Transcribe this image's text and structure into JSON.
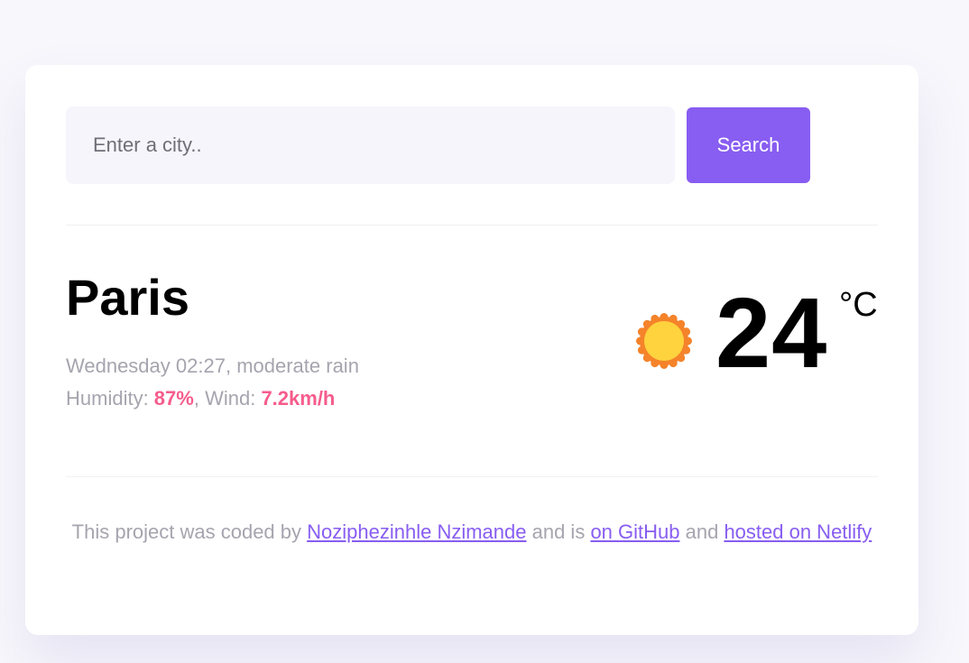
{
  "search": {
    "placeholder": "Enter a city..",
    "value": "",
    "button_label": "Search"
  },
  "weather": {
    "city": "Paris",
    "day_time": "Wednesday 02:27",
    "description": "moderate rain",
    "humidity_label": "Humidity: ",
    "humidity_value": "87%",
    "wind_label": "Wind: ",
    "wind_value": "7.2km/h",
    "temperature": "24",
    "unit": "°C",
    "icon": "sun-icon"
  },
  "footer": {
    "text_1": "This project was coded by ",
    "author_link": "Noziphezinhle Nzimande",
    "text_2": " and is ",
    "github_link": "on GitHub",
    "text_3": " and ",
    "hosted_link": "hosted on Netlify"
  },
  "colors": {
    "accent": "#885df1",
    "highlight": "#f65c8c",
    "muted_text": "#a6a4ae",
    "sun_outer": "#f5832a",
    "sun_inner": "#fed33e"
  }
}
